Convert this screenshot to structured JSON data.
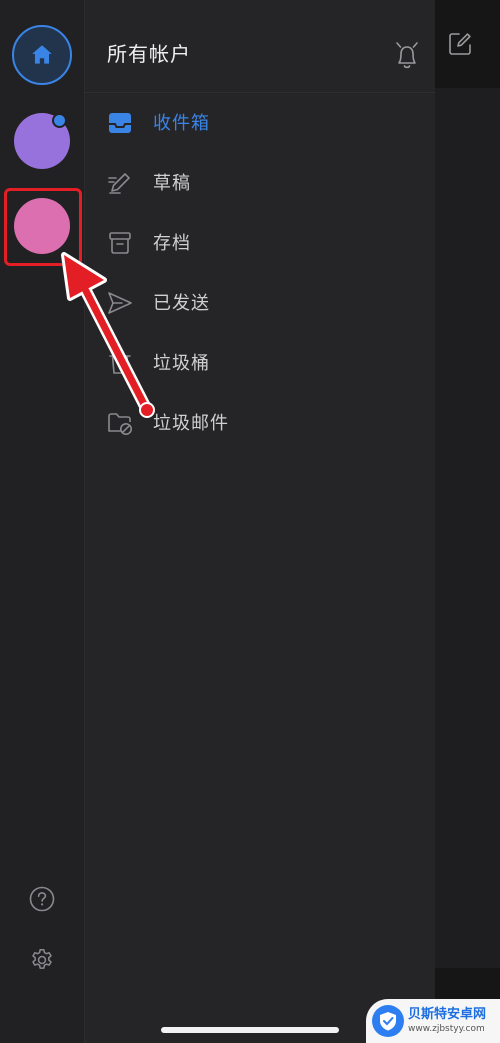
{
  "drawer": {
    "title": "所有帐户",
    "folders": [
      {
        "label": "收件箱",
        "icon": "inbox-icon",
        "active": true
      },
      {
        "label": "草稿",
        "icon": "pencil-icon",
        "active": false
      },
      {
        "label": "存档",
        "icon": "archive-icon",
        "active": false
      },
      {
        "label": "已发送",
        "icon": "send-icon",
        "active": false
      },
      {
        "label": "垃圾桶",
        "icon": "trash-icon",
        "active": false
      },
      {
        "label": "垃圾邮件",
        "icon": "junk-folder-icon",
        "active": false
      }
    ]
  },
  "accounts": [
    {
      "icon": "home-icon",
      "color": "#3a84e6"
    },
    {
      "color": "#9872dc",
      "unread_dot": true
    },
    {
      "color": "#dc6fb0",
      "highlighted": true
    }
  ],
  "colors": {
    "accent": "#3a84e6",
    "annotation": "#e31e24",
    "background": "#232325"
  },
  "watermark": {
    "name": "贝斯特安卓网",
    "url": "www.zjbstyy.com"
  }
}
